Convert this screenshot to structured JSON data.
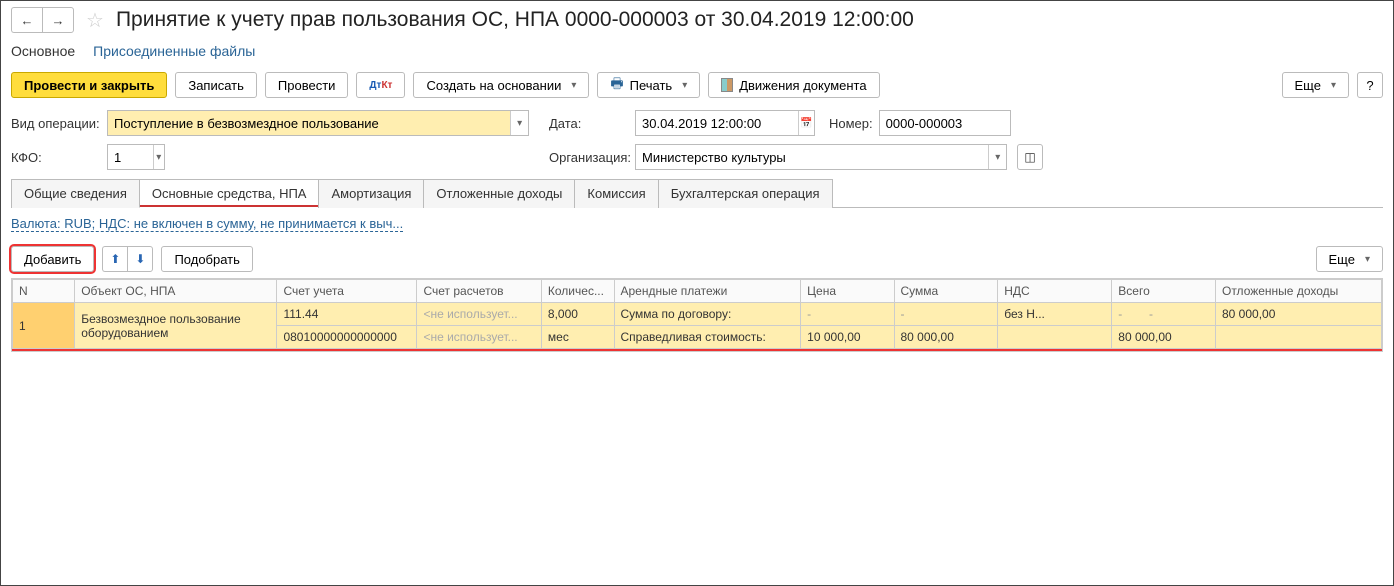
{
  "header": {
    "title": "Принятие к учету прав пользования ОС, НПА 0000-000003 от 30.04.2019 12:00:00"
  },
  "linkTabs": {
    "main": "Основное",
    "files": "Присоединенные файлы"
  },
  "toolbar": {
    "postClose": "Провести и закрыть",
    "write": "Записать",
    "post": "Провести",
    "createBased": "Создать на основании",
    "print": "Печать",
    "movements": "Движения документа",
    "more": "Еще",
    "help": "?"
  },
  "form": {
    "opTypeLabel": "Вид операции:",
    "opType": "Поступление в безвозмездное пользование",
    "dateLabel": "Дата:",
    "date": "30.04.2019 12:00:00",
    "numberLabel": "Номер:",
    "number": "0000-000003",
    "kfoLabel": "КФО:",
    "kfo": "1",
    "orgLabel": "Организация:",
    "org": "Министерство культуры"
  },
  "tabs": {
    "t1": "Общие сведения",
    "t2": "Основные средства, НПА",
    "t3": "Амортизация",
    "t4": "Отложенные доходы",
    "t5": "Комиссия",
    "t6": "Бухгалтерская операция"
  },
  "currencyLink": "Валюта: RUB; НДС: не включен в сумму, не принимается к выч...",
  "tblToolbar": {
    "add": "Добавить",
    "pick": "Подобрать",
    "more": "Еще"
  },
  "columns": {
    "n": "N",
    "obj": "Объект ОС, НПА",
    "acct": "Счет учета",
    "calc": "Счет расчетов",
    "qty": "Количес...",
    "rent": "Арендные платежи",
    "price": "Цена",
    "sum": "Сумма",
    "vat": "НДС",
    "total": "Всего",
    "deferred": "Отложенные доходы"
  },
  "row": {
    "n": "1",
    "obj": "Безвозмездное пользование оборудованием",
    "acct1": "111.44",
    "acct2": "08010000000000000",
    "calc1": "<не использует...",
    "calc2": "<не использует...",
    "qty": "8,000",
    "unit": "мес",
    "rentLabel1": "Сумма по договору:",
    "rentLabel2": "Справедливая стоимость:",
    "price1": "-",
    "price2": "10 000,00",
    "sum1": "-",
    "sum2": "80 000,00",
    "vat1": "без Н...",
    "vat2": "",
    "total1_a": "-",
    "total1_b": "-",
    "total2": "80 000,00",
    "def": "80 000,00"
  }
}
